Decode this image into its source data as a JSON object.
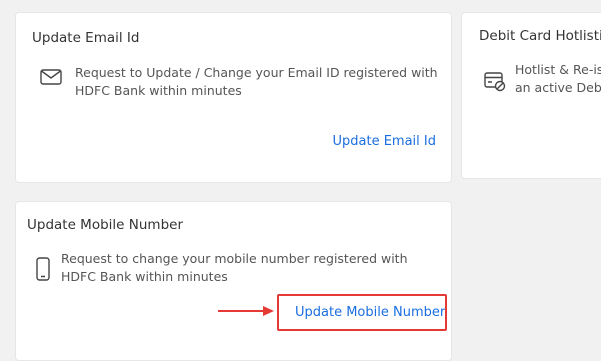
{
  "cards": {
    "email": {
      "title": "Update Email Id",
      "icon": "envelope-icon",
      "description": "Request to Update / Change your Email ID registered with HDFC Bank within minutes",
      "link_label": "Update Email Id"
    },
    "debit": {
      "title": "Debit Card Hotlisting",
      "icon": "card-block-icon",
      "description_line1": "Hotlist & Re-is",
      "description_line2": "an active Debi"
    },
    "mobile": {
      "title": "Update Mobile Number",
      "icon": "mobile-phone-icon",
      "description": "Request to change your mobile number registered with HDFC Bank within minutes",
      "link_label": "Update Mobile Number"
    }
  },
  "annotation": {
    "highlight_color": "#e53935",
    "arrow_icon": "right-arrow-icon"
  },
  "colors": {
    "link": "#1a6ee0",
    "background": "#f1f1f1",
    "card": "#ffffff"
  }
}
